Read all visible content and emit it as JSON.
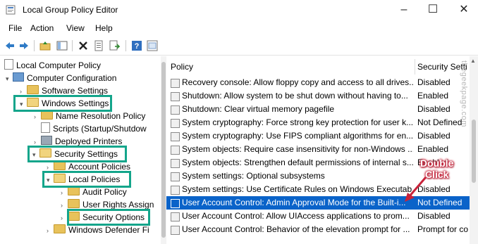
{
  "window": {
    "title": "Local Group Policy Editor"
  },
  "menu": [
    "File",
    "Action",
    "View",
    "Help"
  ],
  "tree": [
    {
      "label": "Local Computer Policy"
    },
    {
      "label": "Computer Configuration"
    },
    {
      "label": "Software Settings"
    },
    {
      "label": "Windows Settings"
    },
    {
      "label": "Name Resolution Policy"
    },
    {
      "label": "Scripts (Startup/Shutdow"
    },
    {
      "label": "Deployed Printers"
    },
    {
      "label": "Security Settings"
    },
    {
      "label": "Account Policies"
    },
    {
      "label": "Local Policies"
    },
    {
      "label": "Audit Policy"
    },
    {
      "label": "User Rights Assign"
    },
    {
      "label": "Security Options"
    },
    {
      "label": "Windows Defender Fi"
    }
  ],
  "columns": {
    "policy": "Policy",
    "setting": "Security Setti"
  },
  "policies": [
    {
      "name": "Recovery console: Allow floppy copy and access to all drives...",
      "setting": "Disabled"
    },
    {
      "name": "Shutdown: Allow system to be shut down without having to...",
      "setting": "Enabled"
    },
    {
      "name": "Shutdown: Clear virtual memory pagefile",
      "setting": "Disabled"
    },
    {
      "name": "System cryptography: Force strong key protection for user k...",
      "setting": "Not Defined"
    },
    {
      "name": "System cryptography: Use FIPS compliant algorithms for en...",
      "setting": "Disabled"
    },
    {
      "name": "System objects: Require case insensitivity for non-Windows ...",
      "setting": "Enabled"
    },
    {
      "name": "System objects: Strengthen default permissions of internal s...",
      "setting": "Enabled"
    },
    {
      "name": "System settings: Optional subsystems",
      "setting": ""
    },
    {
      "name": "System settings: Use Certificate Rules on Windows Executab...",
      "setting": "Disabled"
    },
    {
      "name": "User Account Control: Admin Approval Mode for the Built-i...",
      "setting": "Not Defined"
    },
    {
      "name": "User Account Control: Allow UIAccess applications to prom...",
      "setting": "Disabled"
    },
    {
      "name": "User Account Control: Behavior of the elevation prompt for ...",
      "setting": "Prompt for co"
    }
  ],
  "annotation": {
    "line1": "Double",
    "line2": "Click"
  },
  "watermark": "thegeekpage.com",
  "colors": {
    "selection": "#0a63c9",
    "highlight_box": "#14a58b",
    "callout": "#c8233a"
  }
}
